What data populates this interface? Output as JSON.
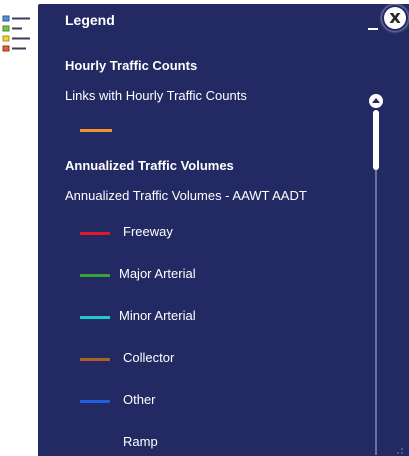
{
  "panel": {
    "title": "Legend",
    "minimize_icon": "minimize-icon",
    "close_icon": "close-icon",
    "close_glyph": "x"
  },
  "widget_icon": "legend-icon",
  "sections": [
    {
      "title": "Hourly Traffic Counts",
      "layer": "Links with Hourly Traffic Counts",
      "items": [
        {
          "label": "",
          "color": "#f0922e"
        }
      ]
    },
    {
      "title": "Annualized Traffic Volumes",
      "layer": "Annualized Traffic Volumes - AAWT AADT",
      "items": [
        {
          "label": "Freeway",
          "color": "#e0192a"
        },
        {
          "label": "Major Arterial",
          "color": "#3ca238"
        },
        {
          "label": "Minor Arterial",
          "color": "#22c8d0"
        },
        {
          "label": "Collector",
          "color": "#a86420"
        },
        {
          "label": "Other",
          "color": "#1f5fe0"
        },
        {
          "label": "Ramp",
          "color": "#ffffff"
        }
      ]
    }
  ],
  "colors": {
    "panel_bg": "#232a63",
    "text": "#ffffff"
  }
}
